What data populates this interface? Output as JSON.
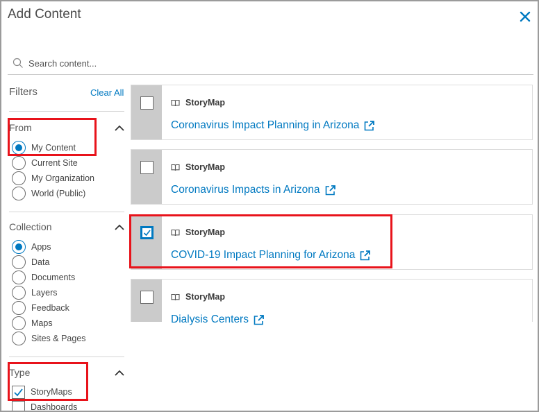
{
  "dialog": {
    "title": "Add Content",
    "close_icon": "close-icon"
  },
  "search": {
    "placeholder": "Search content...",
    "value": "",
    "icon": "search-icon"
  },
  "filters": {
    "heading": "Filters",
    "clear_all": "Clear All",
    "groups": {
      "from": {
        "title": "From",
        "options": [
          {
            "label": "My Content",
            "selected": true
          },
          {
            "label": "Current Site",
            "selected": false
          },
          {
            "label": "My Organization",
            "selected": false
          },
          {
            "label": "World (Public)",
            "selected": false
          }
        ]
      },
      "collection": {
        "title": "Collection",
        "options": [
          {
            "label": "Apps",
            "selected": true
          },
          {
            "label": "Data",
            "selected": false
          },
          {
            "label": "Documents",
            "selected": false
          },
          {
            "label": "Layers",
            "selected": false
          },
          {
            "label": "Feedback",
            "selected": false
          },
          {
            "label": "Maps",
            "selected": false
          },
          {
            "label": "Sites & Pages",
            "selected": false
          }
        ]
      },
      "type": {
        "title": "Type",
        "options": [
          {
            "label": "StoryMaps",
            "checked": true
          },
          {
            "label": "Dashboards",
            "checked": false
          }
        ]
      }
    }
  },
  "results": [
    {
      "type": "StoryMap",
      "title": "Coronavirus Impact Planning in Arizona",
      "checked": false
    },
    {
      "type": "StoryMap",
      "title": "Coronavirus Impacts in Arizona",
      "checked": false
    },
    {
      "type": "StoryMap",
      "title": "COVID-19 Impact Planning for Arizona",
      "checked": true
    },
    {
      "type": "StoryMap",
      "title": "Dialysis Centers",
      "checked": false
    }
  ],
  "colors": {
    "accent": "#0079c1",
    "highlight": "#e8131b",
    "gutter": "#cbcbcb"
  }
}
